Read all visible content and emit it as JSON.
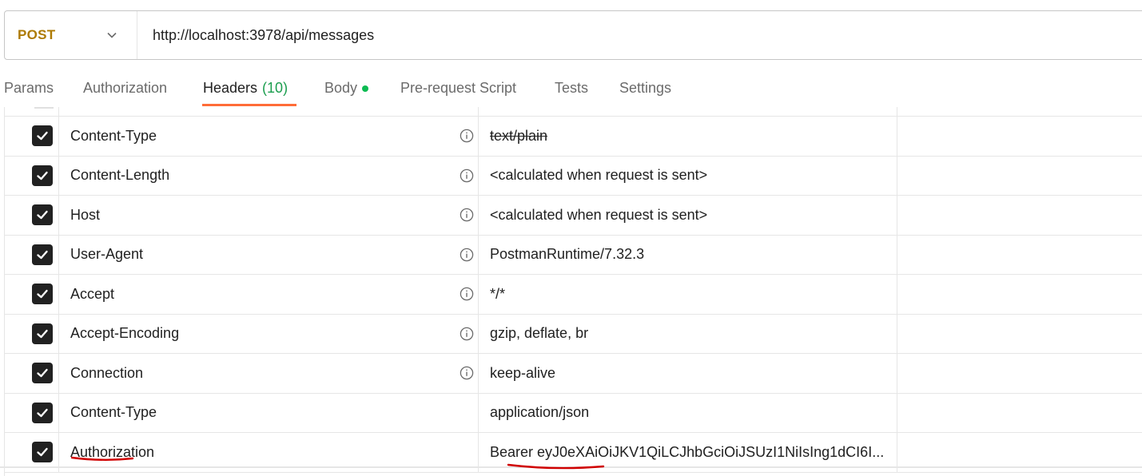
{
  "request": {
    "method": "POST",
    "url": "http://localhost:3978/api/messages"
  },
  "tabs": [
    {
      "label": "Params"
    },
    {
      "label": "Authorization"
    },
    {
      "label": "Headers",
      "count": "(10)"
    },
    {
      "label": "Body"
    },
    {
      "label": "Pre-request Script"
    },
    {
      "label": "Tests"
    },
    {
      "label": "Settings"
    }
  ],
  "headers": [
    {
      "checked": true,
      "key": "Content-Type",
      "value": "text/plain",
      "info": true,
      "struck": true
    },
    {
      "checked": true,
      "key": "Content-Length",
      "value": "<calculated when request is sent>",
      "info": true
    },
    {
      "checked": true,
      "key": "Host",
      "value": "<calculated when request is sent>",
      "info": true
    },
    {
      "checked": true,
      "key": "User-Agent",
      "value": "PostmanRuntime/7.32.3",
      "info": true
    },
    {
      "checked": true,
      "key": "Accept",
      "value": "*/*",
      "info": true
    },
    {
      "checked": true,
      "key": "Accept-Encoding",
      "value": "gzip, deflate, br",
      "info": true
    },
    {
      "checked": true,
      "key": "Connection",
      "value": "keep-alive",
      "info": true
    },
    {
      "checked": true,
      "key": "Content-Type",
      "value": "application/json",
      "info": false
    },
    {
      "checked": true,
      "key": "Authorization",
      "value": "Bearer eyJ0eXAiOiJKV1QiLCJhbGciOiJSUzI1NiIsIng1dCI6I...",
      "info": false
    }
  ],
  "colors": {
    "method": "#ad7a03",
    "active_tab_underline": "#ff6c37",
    "headers_count": "#1c9e4f",
    "body_dot": "#0cbb52",
    "annotation": "#d00000"
  }
}
